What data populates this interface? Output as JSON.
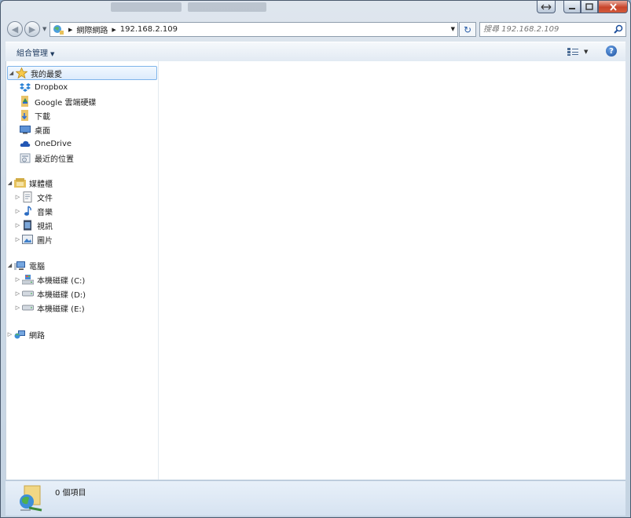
{
  "window": {
    "caption_buttons": [
      "switch",
      "minimize",
      "maximize",
      "close"
    ]
  },
  "nav": {
    "crumbs": [
      "網際網路",
      "192.168.2.109"
    ],
    "search_placeholder": "搜尋 192.168.2.109"
  },
  "toolbar": {
    "organize_label": "組合管理",
    "help_label": "?"
  },
  "sidebar": {
    "favorites": {
      "label": "我的最愛",
      "items": [
        {
          "label": "Dropbox",
          "icon": "dropbox-icon"
        },
        {
          "label": "Google 雲端硬碟",
          "icon": "google-drive-folder-icon"
        },
        {
          "label": "下載",
          "icon": "downloads-folder-icon"
        },
        {
          "label": "桌面",
          "icon": "desktop-icon"
        },
        {
          "label": "OneDrive",
          "icon": "onedrive-icon"
        },
        {
          "label": "最近的位置",
          "icon": "recent-places-icon"
        }
      ]
    },
    "libraries": {
      "label": "媒體櫃",
      "items": [
        {
          "label": "文件",
          "icon": "documents-icon"
        },
        {
          "label": "音樂",
          "icon": "music-icon"
        },
        {
          "label": "視訊",
          "icon": "video-icon"
        },
        {
          "label": "圖片",
          "icon": "pictures-icon"
        }
      ]
    },
    "computer": {
      "label": "電腦",
      "items": [
        {
          "label": "本機磁碟 (C:)",
          "icon": "system-drive-icon"
        },
        {
          "label": "本機磁碟 (D:)",
          "icon": "drive-icon"
        },
        {
          "label": "本機磁碟 (E:)",
          "icon": "drive-icon"
        }
      ]
    },
    "network": {
      "label": "網路"
    }
  },
  "status": {
    "text": "0 個項目"
  },
  "colors": {
    "selection_border": "#7eb4ea",
    "close_button": "#c8452b",
    "window_frame": "#c4d3e2"
  }
}
